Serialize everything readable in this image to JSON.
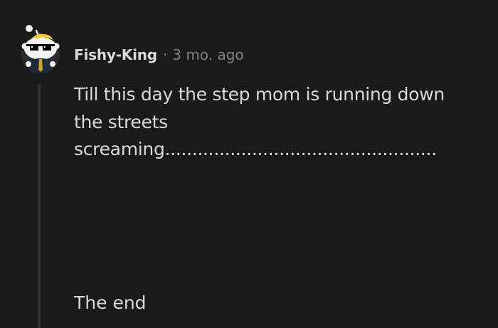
{
  "comment": {
    "author": "Fishy-King",
    "separator": "·",
    "timestamp": "3 mo. ago",
    "avatar_icon": "snoo-avatar-with-sunglasses-icon",
    "body_lines": [
      "Till this day the step mom is running down",
      "the streets",
      "screaming.................................................."
    ],
    "ending": "The end"
  },
  "colors": {
    "background": "#1a1a1b",
    "text": "#d7dadc",
    "muted": "#818384",
    "thread_line": "#343536"
  }
}
